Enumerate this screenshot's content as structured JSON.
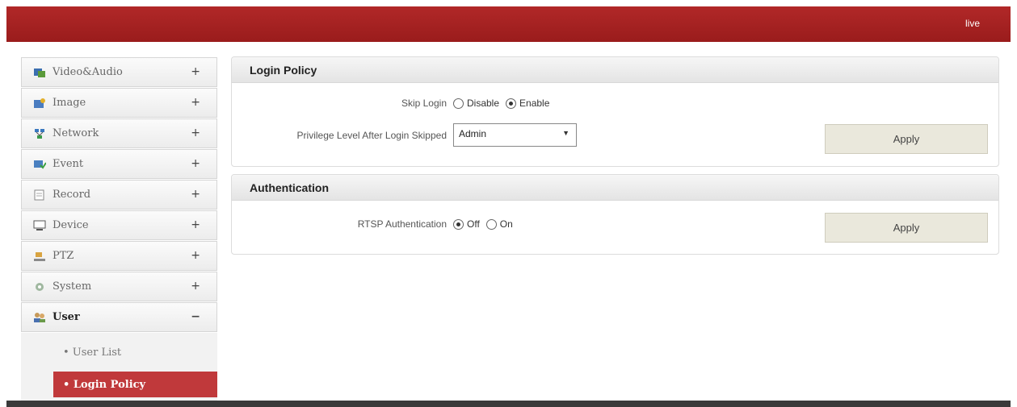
{
  "header": {
    "live_label": "live"
  },
  "sidebar": {
    "items": [
      {
        "label": "Video&Audio",
        "icon": "video-audio-icon",
        "sign": "+"
      },
      {
        "label": "Image",
        "icon": "image-icon",
        "sign": "+"
      },
      {
        "label": "Network",
        "icon": "network-icon",
        "sign": "+"
      },
      {
        "label": "Event",
        "icon": "event-icon",
        "sign": "+"
      },
      {
        "label": "Record",
        "icon": "record-icon",
        "sign": "+"
      },
      {
        "label": "Device",
        "icon": "device-icon",
        "sign": "+"
      },
      {
        "label": "PTZ",
        "icon": "ptz-icon",
        "sign": "+"
      },
      {
        "label": "System",
        "icon": "system-icon",
        "sign": "+"
      },
      {
        "label": "User",
        "icon": "user-icon",
        "sign": "−"
      }
    ],
    "sub_items": [
      {
        "label": "• User List"
      },
      {
        "label": "• Login Policy"
      }
    ]
  },
  "login_policy": {
    "title": "Login Policy",
    "skip_login_label": "Skip Login",
    "skip_login_options": [
      "Disable",
      "Enable"
    ],
    "skip_login_selected": "Enable",
    "privilege_label": "Privilege Level After Login Skipped",
    "privilege_value": "Admin",
    "apply_label": "Apply"
  },
  "authentication": {
    "title": "Authentication",
    "rtsp_label": "RTSP Authentication",
    "rtsp_options": [
      "Off",
      "On"
    ],
    "rtsp_selected": "Off",
    "apply_label": "Apply"
  },
  "colors": {
    "brand_red": "#a51f1f",
    "active_menu": "#c0393b",
    "apply_button": "#eae8dc"
  }
}
